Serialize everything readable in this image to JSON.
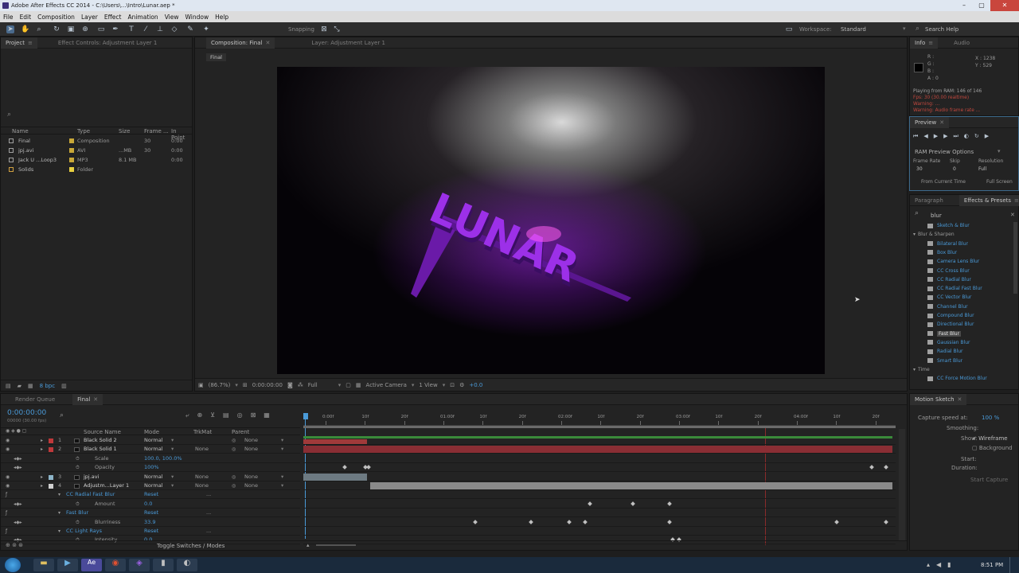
{
  "window": {
    "title": "Adobe After Effects CC 2014 - C:\\Users\\...\\Intro\\Lunar.aep *"
  },
  "menu": [
    "File",
    "Edit",
    "Composition",
    "Layer",
    "Effect",
    "Animation",
    "View",
    "Window",
    "Help"
  ],
  "toolbar": {
    "snapping": "Snapping",
    "workspace_label": "Workspace:",
    "workspace_value": "Standard",
    "search_placeholder": "Search Help"
  },
  "project": {
    "tabs": [
      "Project",
      "Effect Controls: Adjustment Layer 1"
    ],
    "columns": [
      "Name",
      "Type",
      "Size",
      "Frame ...",
      "In Point"
    ],
    "items": [
      {
        "name": "Final",
        "type": "Composition",
        "size": "",
        "frame": "30",
        "in": "0:00"
      },
      {
        "name": "jpj.avi",
        "type": "AVI",
        "size": "...MB",
        "frame": "30",
        "in": "0:00"
      },
      {
        "name": "Jack U ...Loop3",
        "type": "MP3",
        "size": "8.1 MB",
        "frame": "",
        "in": "0:00"
      },
      {
        "name": "Solids",
        "type": "Folder",
        "size": "",
        "frame": "",
        "in": ""
      }
    ],
    "bpc": "8 bpc"
  },
  "composition": {
    "tabs": [
      "Composition: Final",
      "Layer: Adjustment Layer 1"
    ],
    "sub_tab": "Final",
    "viewer_text": "LUNAR",
    "footer": {
      "zoom": "(86.7%)",
      "time": "0:00:00:00",
      "resolution": "Full",
      "camera": "Active Camera",
      "views": "1 View",
      "exposure": "+0.0"
    }
  },
  "info": {
    "tabs": [
      "Info",
      "Audio"
    ],
    "rgba": [
      "R :",
      "G :",
      "B :",
      "A : 0"
    ],
    "xy": [
      "X : 1238",
      "Y : 529"
    ],
    "lines": [
      "Playing from RAM: 146 of 146",
      "Fps: 30 (30.00 realtime)",
      "Warning: ...",
      "Warning: Audio frame rate ..."
    ]
  },
  "preview": {
    "tab": "Preview",
    "options": "RAM Preview Options",
    "labels": [
      "Frame Rate",
      "Skip",
      "Resolution"
    ],
    "values": [
      "30",
      "0",
      "Full"
    ],
    "from_current": "From Current Time",
    "full_screen": "Full Screen"
  },
  "effects": {
    "tabs": [
      "Paragraph",
      "Effects & Presets"
    ],
    "search_value": "blur",
    "items": [
      {
        "label": "Sketch & Blur",
        "indent": 2,
        "selected": false
      },
      {
        "label": "Blur & Sharpen",
        "indent": 0,
        "selected": false
      },
      {
        "label": "Bilateral Blur",
        "indent": 2,
        "selected": false
      },
      {
        "label": "Box Blur",
        "indent": 2,
        "selected": false
      },
      {
        "label": "Camera Lens Blur",
        "indent": 2,
        "selected": false
      },
      {
        "label": "CC Cross Blur",
        "indent": 2,
        "selected": false
      },
      {
        "label": "CC Radial Blur",
        "indent": 2,
        "selected": false
      },
      {
        "label": "CC Radial Fast Blur",
        "indent": 2,
        "selected": false
      },
      {
        "label": "CC Vector Blur",
        "indent": 2,
        "selected": false
      },
      {
        "label": "Channel Blur",
        "indent": 2,
        "selected": false
      },
      {
        "label": "Compound Blur",
        "indent": 2,
        "selected": false
      },
      {
        "label": "Directional Blur",
        "indent": 2,
        "selected": false
      },
      {
        "label": "Fast Blur",
        "indent": 2,
        "selected": true
      },
      {
        "label": "Gaussian Blur",
        "indent": 2,
        "selected": false
      },
      {
        "label": "Radial Blur",
        "indent": 2,
        "selected": false
      },
      {
        "label": "Smart Blur",
        "indent": 2,
        "selected": false
      },
      {
        "label": "Time",
        "indent": 0,
        "selected": false
      },
      {
        "label": "CC Force Motion Blur",
        "indent": 2,
        "selected": false
      }
    ]
  },
  "motion_sketch": {
    "tab": "Motion Sketch",
    "capture_speed": "Capture speed at:",
    "capture_value": "100 %",
    "smoothing": "Smoothing:",
    "show": "Show:",
    "wireframe": "Wireframe",
    "background": "Background",
    "start": "Start:",
    "duration": "Duration:",
    "start_capture": "Start Capture"
  },
  "timeline": {
    "tabs": [
      "Render Queue",
      "Final"
    ],
    "timecode": "0:00:00:00",
    "fps_label": "00000 (30.00 fps)",
    "columns": [
      "Source Name",
      "Mode",
      "TrkMat",
      "Parent"
    ],
    "ruler": [
      "0:00f",
      "10f",
      "20f",
      "01:00f",
      "10f",
      "20f",
      "02:00f",
      "10f",
      "20f",
      "03:00f",
      "10f",
      "20f",
      "04:00f",
      "10f",
      "20f"
    ],
    "rows": [
      {
        "num": "1",
        "name": "Black Solid 2",
        "mode": "Normal",
        "trk": "",
        "parent": "None",
        "color": "#c0393b",
        "type": "layer"
      },
      {
        "num": "2",
        "name": "Black Solid 1",
        "mode": "Normal",
        "trk": "None",
        "parent": "None",
        "color": "#c0393b",
        "type": "layer"
      },
      {
        "num": "",
        "name": "Scale",
        "mode": "100.0, 100.0%",
        "trk": "",
        "parent": "",
        "color": "",
        "type": "prop"
      },
      {
        "num": "",
        "name": "Opacity",
        "mode": "100%",
        "trk": "",
        "parent": "",
        "color": "",
        "type": "prop"
      },
      {
        "num": "3",
        "name": "jpj.avi",
        "mode": "Normal",
        "trk": "None",
        "parent": "None",
        "color": "#8db5c9",
        "type": "layer"
      },
      {
        "num": "4",
        "name": "Adjustm...Layer 1",
        "mode": "Normal",
        "trk": "None",
        "parent": "None",
        "color": "#d0d0d0",
        "type": "layer"
      },
      {
        "num": "",
        "name": "CC Radial Fast Blur",
        "mode": "Reset",
        "trk": "",
        "parent": "...",
        "color": "",
        "type": "fx"
      },
      {
        "num": "",
        "name": "Amount",
        "mode": "0.0",
        "trk": "",
        "parent": "",
        "color": "",
        "type": "prop"
      },
      {
        "num": "",
        "name": "Fast Blur",
        "mode": "Reset",
        "trk": "",
        "parent": "...",
        "color": "",
        "type": "fx"
      },
      {
        "num": "",
        "name": "Blurriness",
        "mode": "33.9",
        "trk": "",
        "parent": "",
        "color": "",
        "type": "prop"
      },
      {
        "num": "",
        "name": "CC Light Rays",
        "mode": "Reset",
        "trk": "",
        "parent": "...",
        "color": "",
        "type": "fx"
      },
      {
        "num": "",
        "name": "Intensity",
        "mode": "0.0",
        "trk": "",
        "parent": "",
        "color": "",
        "type": "prop"
      }
    ],
    "toggle": "Toggle Switches / Modes"
  },
  "taskbar": {
    "time": "8:51 PM"
  }
}
